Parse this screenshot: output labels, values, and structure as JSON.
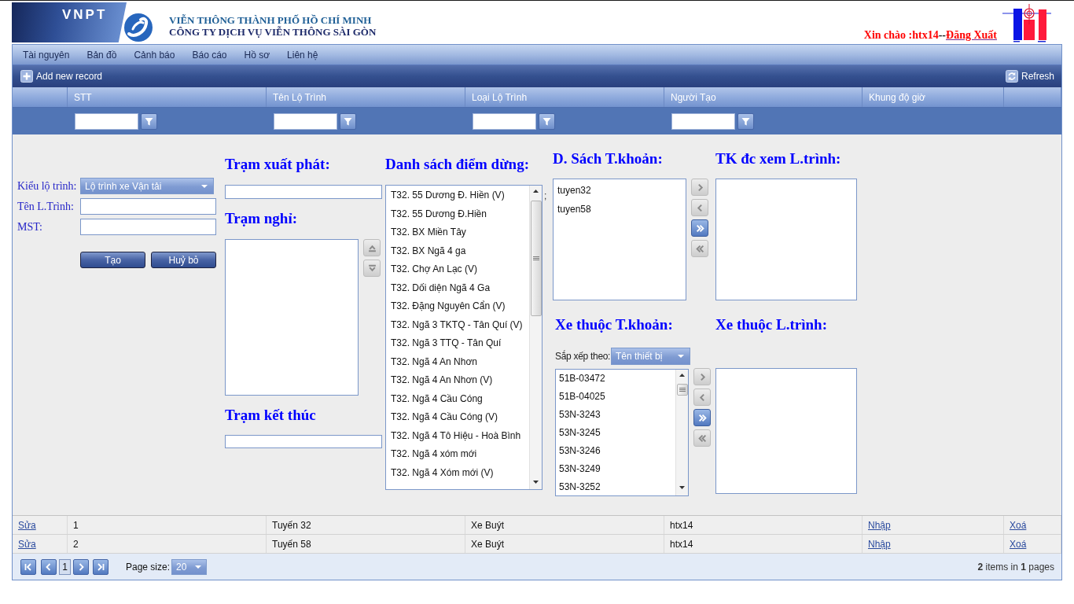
{
  "header": {
    "brand_text": "VNPT",
    "org_name": "VIỄN THÔNG THÀNH PHỐ HỒ CHÍ MINH",
    "company_name": "CÔNG TY DỊCH VỤ VIỄN THÔNG SÀI GÒN",
    "greeting": "Xin chào :htx14",
    "separator": "--",
    "logout_link": "Đăng Xuất"
  },
  "menu": [
    "Tài nguyên",
    "Bản đồ",
    "Cảnh báo",
    "Báo cáo",
    "Hồ sơ",
    "Liên hệ"
  ],
  "toolbar": {
    "add_button": "Add new record",
    "refresh_button": "Refresh"
  },
  "grid_columns": [
    {
      "label": "STT",
      "filter": true
    },
    {
      "label": "Tên Lộ Trình",
      "filter": true
    },
    {
      "label": "Loại Lộ Trình",
      "filter": true
    },
    {
      "label": "Người Tạo",
      "filter": true
    },
    {
      "label": "Khung độ giờ",
      "filter": false
    }
  ],
  "edit_form": {
    "route_fields": [
      {
        "kind": "select",
        "label": "Kiểu lộ trình:",
        "value": "Lộ trình xe Vận tải"
      },
      {
        "kind": "input",
        "label": "Tên L.Trình:"
      },
      {
        "kind": "input",
        "label": "MST:"
      }
    ],
    "buttons": [
      "Tạo",
      "Huỷ bỏ"
    ],
    "start_station": {
      "title": "Trạm xuất phát:"
    },
    "rest_stations": {
      "title": "Trạm nghỉ:",
      "order_buttons": [
        {
          "kind": "up",
          "disabled": true
        },
        {
          "kind": "down",
          "disabled": true
        }
      ]
    },
    "end_station": {
      "title": "Trạm kết thúc"
    },
    "stop_list": {
      "title": "Danh sách điểm dừng:",
      "items": [
        "T32. 55 Dương Đ. Hiền (V)",
        "T32. 55 Dương Đ.Hiền",
        "T32. BX Miền Tây",
        "T32. BX Ngã 4 ga",
        "T32. Chợ An Lạc (V)",
        "T32. Dối diện Ngã 4 Ga",
        "T32. Đặng Nguyên Cẩn (V)",
        "T32. Ngã 3 TKTQ - Tân Quí (V)",
        "T32. Ngã 3 TTQ - Tân Quí",
        "T32. Ngã 4 An Nhơn",
        "T32. Ngã 4 An Nhơn (V)",
        "T32. Ngã 4 Cầu Cóng",
        "T32. Ngã 4 Cầu Cóng (V)",
        "T32. Ngã 4 Tô Hiệu - Hoà Bình",
        "T32. Ngã 4 xóm mới",
        "T32. Ngã 4 Xóm mới (V)"
      ],
      "stray_mark": ";"
    },
    "accounts": {
      "title": "D. Sách T.khoản:",
      "items": [
        "tuyen32",
        "tuyen58"
      ],
      "transfer_buttons": [
        {
          "kind": "move_right",
          "disabled": true
        },
        {
          "kind": "move_left",
          "disabled": true
        },
        {
          "kind": "move_all_right",
          "disabled": false
        },
        {
          "kind": "move_all_left",
          "disabled": true
        }
      ]
    },
    "viewer_accounts": {
      "title": "TK đc xem L.trình:"
    },
    "account_vehicles": {
      "title": "Xe thuộc T.khoản:",
      "sort_label": "Sắp xếp theo:",
      "sort_value": "Tên thiết bị",
      "items": [
        "51B-03472",
        "51B-04025",
        "53N-3243",
        "53N-3245",
        "53N-3246",
        "53N-3249",
        "53N-3252"
      ],
      "transfer_buttons": [
        {
          "kind": "move_right",
          "disabled": true
        },
        {
          "kind": "move_left",
          "disabled": true
        },
        {
          "kind": "move_all_right",
          "disabled": false
        },
        {
          "kind": "move_all_left",
          "disabled": true
        }
      ]
    },
    "route_vehicles": {
      "title": "Xe thuộc L.trình:"
    }
  },
  "grid_rows": [
    {
      "cells": [
        {
          "kind": "link",
          "text": "Sửa"
        },
        {
          "kind": "text",
          "text": "1"
        },
        {
          "kind": "text",
          "text": "Tuyến 32"
        },
        {
          "kind": "text",
          "text": "Xe Buýt"
        },
        {
          "kind": "text",
          "text": "htx14"
        },
        {
          "kind": "link",
          "text": "Nhập"
        },
        {
          "kind": "link",
          "text": "Xoá"
        }
      ]
    },
    {
      "cells": [
        {
          "kind": "link",
          "text": "Sửa"
        },
        {
          "kind": "text",
          "text": "2"
        },
        {
          "kind": "text",
          "text": "Tuyến 58"
        },
        {
          "kind": "text",
          "text": "Xe Buýt"
        },
        {
          "kind": "text",
          "text": "htx14"
        },
        {
          "kind": "link",
          "text": "Nhập"
        },
        {
          "kind": "link",
          "text": "Xoá"
        }
      ]
    }
  ],
  "pager": {
    "pages": [
      {
        "label": "1",
        "selected": true
      }
    ],
    "page_size_label": "Page size:",
    "page_size": "20",
    "summary": "**2** items in **1** pages"
  }
}
